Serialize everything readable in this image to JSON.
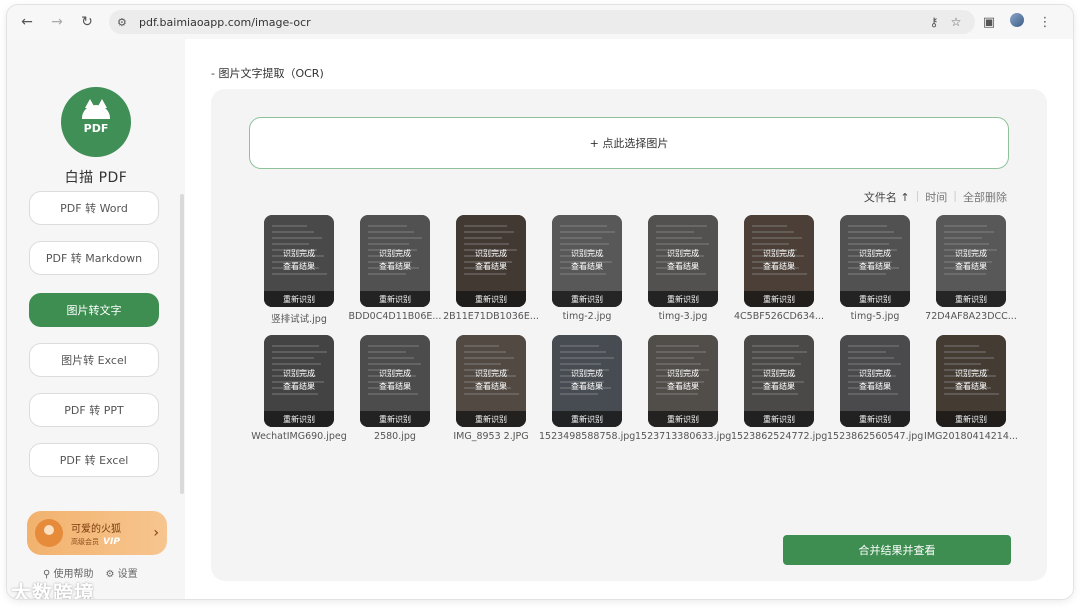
{
  "browser": {
    "url": "pdf.baimiaoapp.com/image-ocr",
    "back_icon": "arrow-left-icon",
    "forward_icon": "arrow-right-icon",
    "reload_icon": "reload-icon"
  },
  "sidebar": {
    "app_name": "白描 PDF",
    "items": [
      {
        "label": "PDF 转 Word",
        "active": false
      },
      {
        "label": "PDF 转 Markdown",
        "active": false
      },
      {
        "label": "图片转文字",
        "active": true
      },
      {
        "label": "图片转 Excel",
        "active": false
      },
      {
        "label": "PDF 转 PPT",
        "active": false
      },
      {
        "label": "PDF 转 Excel",
        "active": false
      }
    ],
    "vip": {
      "name": "可爱的火狐",
      "sub": "高级会员",
      "badge": "VIP"
    },
    "help_label": "使用帮助",
    "settings_label": "设置",
    "watermark": "大数跨境"
  },
  "main": {
    "page_title": "- 图片文字提取（OCR)",
    "upload_label": "+ 点此选择图片",
    "sort": {
      "by_name": "文件名 ↑",
      "by_time": "时间",
      "delete_all": "全部删除"
    },
    "status_done": "识别完成",
    "view_result": "查看结果",
    "redo_label": "重新识别",
    "files": [
      {
        "name": "竖排试试.jpg",
        "tone": "#5a5a5a"
      },
      {
        "name": "BDD0C4D11B06E...",
        "tone": "#6a6a6a"
      },
      {
        "name": "2B11E71DB1036E...",
        "tone": "#4a3526"
      },
      {
        "name": "timg-2.jpg",
        "tone": "#7a7a7a"
      },
      {
        "name": "timg-3.jpg",
        "tone": "#6e6a66"
      },
      {
        "name": "4C5BF526CD634...",
        "tone": "#5e4432"
      },
      {
        "name": "timg-5.jpg",
        "tone": "#6c6c6c"
      },
      {
        "name": "72D4AF8A23DCC...",
        "tone": "#7b7b7b"
      },
      {
        "name": "WechatIMG690.jpeg",
        "tone": "#4d4d4d"
      },
      {
        "name": "2580.jpg",
        "tone": "#5f5f5f"
      },
      {
        "name": "IMG_8953 2.JPG",
        "tone": "#6a5a4a"
      },
      {
        "name": "1523498588758.jpg",
        "tone": "#55606e"
      },
      {
        "name": "1523713380633.jpg",
        "tone": "#6a6258"
      },
      {
        "name": "1523862524772.jpg",
        "tone": "#5e5a56"
      },
      {
        "name": "1523862560547.jpg",
        "tone": "#5c5a5e"
      },
      {
        "name": "IMG20180414214...",
        "tone": "#4e3a28"
      }
    ],
    "merge_label": "合并结果并查看"
  }
}
